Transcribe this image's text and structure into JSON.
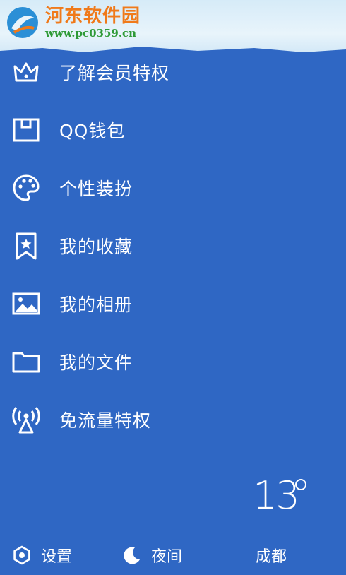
{
  "watermark": {
    "title": "河东软件园",
    "url": "www.pc0359.cn"
  },
  "menu": {
    "items": [
      {
        "label": "了解会员特权",
        "icon": "crown-icon"
      },
      {
        "label": "QQ钱包",
        "icon": "wallet-icon"
      },
      {
        "label": "个性装扮",
        "icon": "palette-icon"
      },
      {
        "label": "我的收藏",
        "icon": "bookmark-star-icon"
      },
      {
        "label": "我的相册",
        "icon": "image-icon"
      },
      {
        "label": "我的文件",
        "icon": "folder-icon"
      },
      {
        "label": "免流量特权",
        "icon": "broadcast-icon"
      }
    ]
  },
  "weather": {
    "temperature": "13",
    "city": "成都"
  },
  "bottom": {
    "settings_label": "设置",
    "night_label": "夜间"
  },
  "colors": {
    "background": "#2f67c4",
    "header": "#d6ebf8",
    "watermark_title": "#f07a1a",
    "watermark_url": "#2f9a37"
  }
}
